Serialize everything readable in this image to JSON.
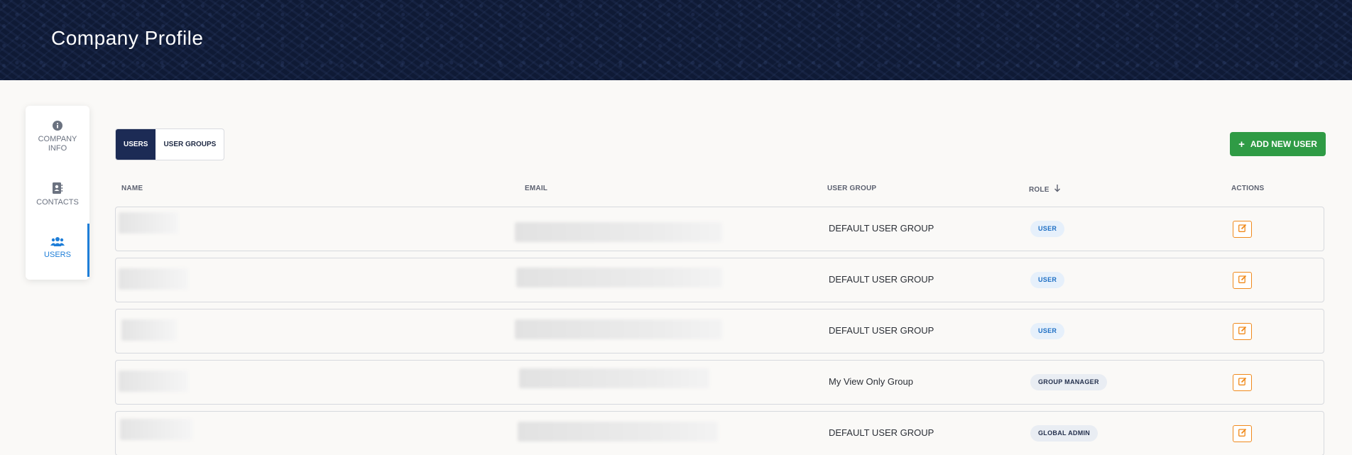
{
  "header": {
    "title": "Company Profile"
  },
  "sidebar": {
    "items": [
      {
        "label": "COMPANY INFO",
        "icon": "info-icon",
        "active": false
      },
      {
        "label": "CONTACTS",
        "icon": "contacts-icon",
        "active": false
      },
      {
        "label": "USERS",
        "icon": "users-icon",
        "active": true
      }
    ]
  },
  "tabs": [
    {
      "label": "USERS",
      "active": true
    },
    {
      "label": "USER GROUPS",
      "active": false
    }
  ],
  "toolbar": {
    "add_user_label": "ADD NEW USER",
    "add_icon": "plus-icon"
  },
  "table": {
    "headers": {
      "name": "NAME",
      "email": "EMAIL",
      "user_group": "USER GROUP",
      "role": "ROLE",
      "actions": "ACTIONS"
    },
    "sort": {
      "column": "role",
      "direction": "descending",
      "icon": "arrow-down-icon"
    },
    "rows": [
      {
        "user_group": "DEFAULT USER GROUP",
        "role": "USER"
      },
      {
        "user_group": "DEFAULT USER GROUP",
        "role": "USER"
      },
      {
        "user_group": "DEFAULT USER GROUP",
        "role": "USER"
      },
      {
        "user_group": "My View Only Group",
        "role": "GROUP MANAGER"
      },
      {
        "user_group": "DEFAULT USER GROUP",
        "role": "GLOBAL ADMIN"
      }
    ]
  },
  "colors": {
    "banner": "#0f1a35",
    "accent": "#1e7ed8",
    "primary_button": "#2f9b45",
    "edit_border": "#f08a1c",
    "tab_active": "#1c2b55"
  }
}
